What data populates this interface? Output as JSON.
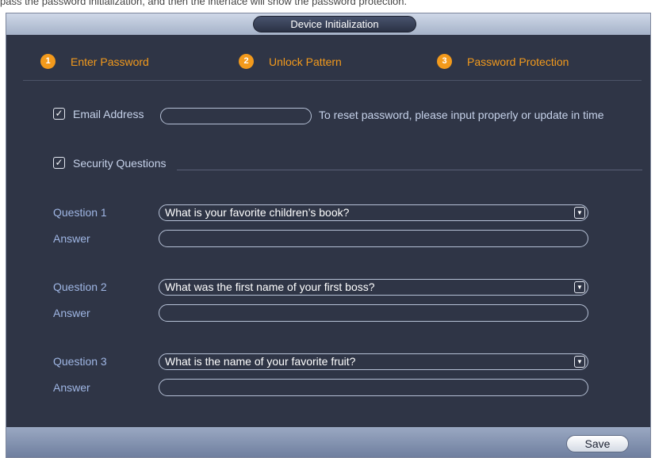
{
  "page": {
    "top_text": "pass the password initialization, and then the interface will show the password protection."
  },
  "window": {
    "title": "Device Initialization"
  },
  "steps": [
    {
      "number": "1",
      "label": "Enter Password"
    },
    {
      "number": "2",
      "label": "Unlock Pattern"
    },
    {
      "number": "3",
      "label": "Password Protection"
    }
  ],
  "email": {
    "checked": true,
    "label": "Email Address",
    "value": "",
    "hint": "To reset password, please input properly or update in time"
  },
  "security": {
    "checked": true,
    "label": "Security Questions"
  },
  "questions": [
    {
      "label": "Question 1",
      "value": "What is your favorite children’s book?",
      "answer_label": "Answer",
      "answer": ""
    },
    {
      "label": "Question 2",
      "value": "What was the first name of your first boss?",
      "answer_label": "Answer",
      "answer": ""
    },
    {
      "label": "Question 3",
      "value": "What is the name of your favorite fruit?",
      "answer_label": "Answer",
      "answer": ""
    }
  ],
  "footer": {
    "save_label": "Save"
  },
  "colors": {
    "accent": "#f39a1c",
    "panel": "#2f3546",
    "label": "#9fb6e4"
  },
  "icons": {
    "checkbox": "checkmark-icon",
    "dropdown": "chevron-down-icon"
  }
}
